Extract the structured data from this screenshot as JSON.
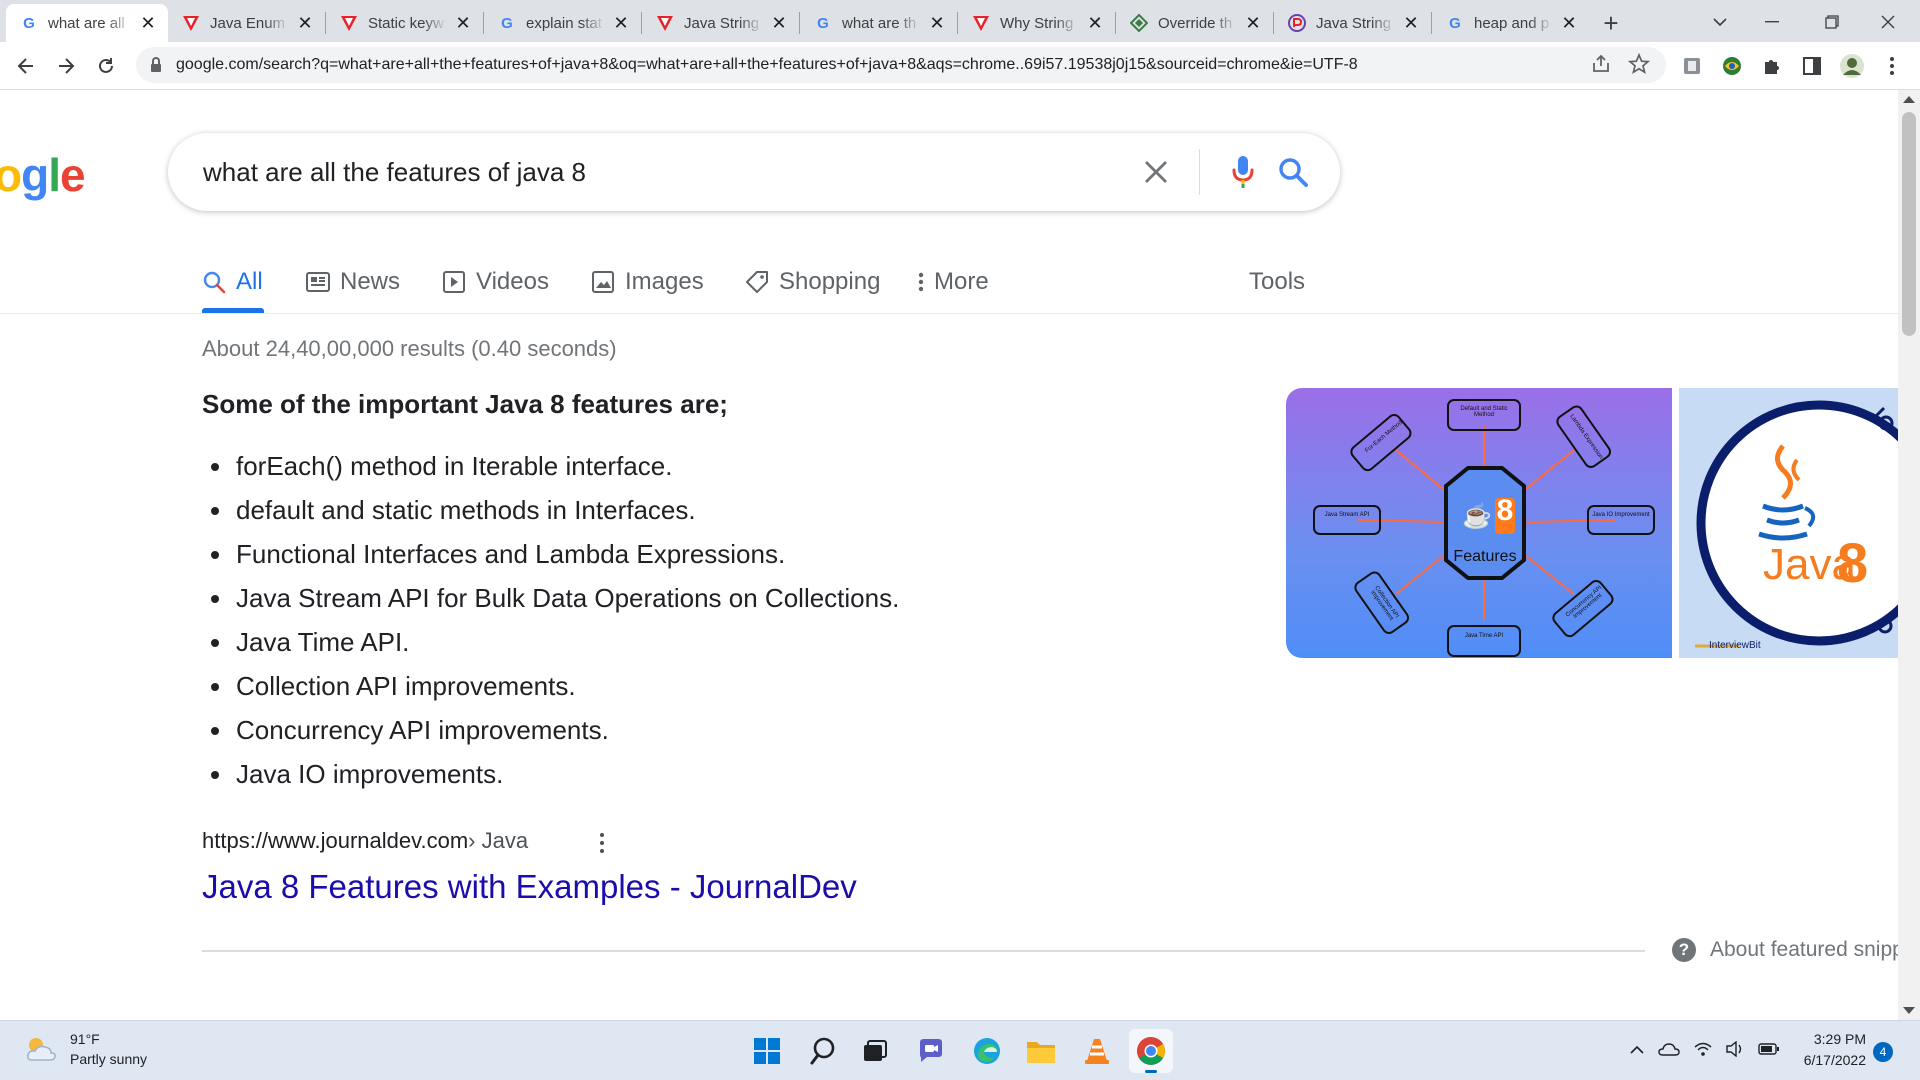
{
  "browser": {
    "tabs": [
      {
        "title": "what are all",
        "icon": "google-icon",
        "active": true
      },
      {
        "title": "Java Enum",
        "icon": "v-icon"
      },
      {
        "title": "Static keyw",
        "icon": "v-icon"
      },
      {
        "title": "explain stat",
        "icon": "google-icon"
      },
      {
        "title": "Java String",
        "icon": "v-icon"
      },
      {
        "title": "what are th",
        "icon": "google-icon"
      },
      {
        "title": "Why String",
        "icon": "v-icon"
      },
      {
        "title": "Override th",
        "icon": "diamond-icon"
      },
      {
        "title": "Java String",
        "icon": "p-icon"
      },
      {
        "title": "heap and p",
        "icon": "google-icon"
      }
    ],
    "url": "google.com/search?q=what+are+all+the+features+of+java+8&oq=what+are+all+the+features+of+java+8&aqs=chrome..69i57.19538j0j15&sourceid=chrome&ie=UTF-8"
  },
  "google": {
    "logo_text": "ogle",
    "query": "what are all the features of java 8",
    "tabs": [
      {
        "label": "All",
        "icon": "search-icon",
        "active": true
      },
      {
        "label": "News",
        "icon": "news-icon"
      },
      {
        "label": "Videos",
        "icon": "video-icon"
      },
      {
        "label": "Images",
        "icon": "image-icon"
      },
      {
        "label": "Shopping",
        "icon": "tag-icon"
      },
      {
        "label": "More",
        "icon": "more-vert-icon"
      }
    ],
    "tools_label": "Tools",
    "result_stats": "About 24,40,00,000 results (0.40 seconds)",
    "snippet": {
      "heading": "Some of the important Java 8 features are;",
      "items": [
        "forEach() method in Iterable interface.",
        "default and static methods in Interfaces.",
        "Functional Interfaces and Lambda Expressions.",
        "Java Stream API for Bulk Data Operations on Collections.",
        "Java Time API.",
        "Collection API improvements.",
        "Concurrency API improvements.",
        "Java IO improvements."
      ],
      "cite_url": "https://www.journaldev.com",
      "cite_crumb": " › Java",
      "title": "Java 8 Features with Examples - JournalDev",
      "about_label": "About featured snipp"
    },
    "images": {
      "img1_center_label": "Features",
      "img1_badge": "8",
      "img1_nodes": [
        "Default and Static Method",
        "Lambda Expression",
        "Java IO Improvement",
        "Concurrency API Improvement",
        "Java Time API",
        "Collection API Improvement",
        "Java Stream API",
        "For-Each Method"
      ],
      "img2_text": "Java",
      "img2_badge": "8",
      "img2_brand": "InterviewBit"
    }
  },
  "taskbar": {
    "weather_temp": "91°F",
    "weather_desc": "Partly sunny",
    "time": "3:29 PM",
    "date": "6/17/2022",
    "notification_count": "4",
    "colors": {
      "accent": "#0067c0",
      "google_blue": "#1a73e8",
      "link": "#1a0dab"
    }
  }
}
